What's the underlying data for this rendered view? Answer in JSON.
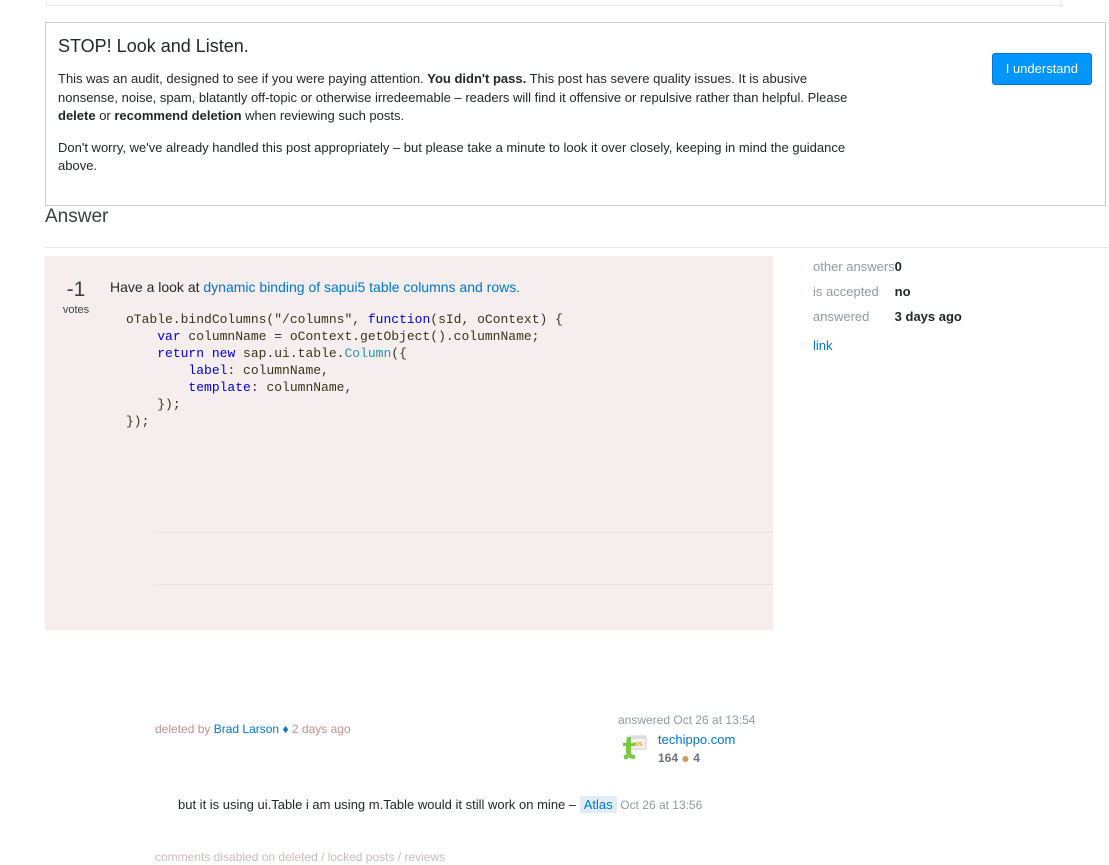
{
  "audit": {
    "title": "STOP! Look and Listen.",
    "para1_a": "This was an audit, designed to see if you were paying attention. ",
    "para1_bold1": "You didn't pass.",
    "para1_b": " This post has severe quality issues. It is abusive nonsense, noise, spam, blatantly off-topic or otherwise irredeemable – readers will find it offensive or repulsive rather than helpful. Please ",
    "para1_bold2": "delete",
    "para1_c": " or ",
    "para1_bold3": "recommend deletion",
    "para1_d": " when reviewing such posts.",
    "para2": "Don't worry, we've already handled this post appropriately – but please take a minute to look it over closely, keeping in mind the guidance above.",
    "button_label": "I understand",
    "button_color": "#0095ff"
  },
  "answer_section": {
    "heading": "Answer"
  },
  "post": {
    "vote_count": "-1",
    "vote_label": "votes",
    "body_prefix": "Have a look at ",
    "body_link": "dynamic binding of sapui5 table columns and rows.",
    "code": {
      "line1_a": "oTable.bindColumns(",
      "line1_str": "\"/columns\"",
      "line1_b": ", ",
      "line1_kw": "function",
      "line1_c": "(sId, oContext) {",
      "line2_kw": "var",
      "line2_a": " columnName = oContext.getObject().columnName;",
      "line3_kw1": "return",
      "line3_kw2": "new",
      "line3_a": " sap.ui.table.",
      "line3_type": "Column",
      "line3_b": "({",
      "line4_prop": "label",
      "line4_a": ": columnName,",
      "line5_prop": "template",
      "line5_a": ": columnName,",
      "line6": "});",
      "line7": "});"
    },
    "deleted_by_prefix": "deleted by ",
    "deleted_by_user": "Brad Larson",
    "mod_diamond": "♦",
    "deleted_when": "2 days ago",
    "answered_when": "answered Oct 26 at 13:54",
    "author_name": "techippo.com",
    "author_rep": "164",
    "badge_dot": "●",
    "badge_count": "4",
    "avatar_name": "techippo-avatar"
  },
  "comment": {
    "text": "but it is using ui.Table i am using m.Table would it still work on mine – ",
    "user": "Atlas",
    "date": "Oct 26 at 13:56",
    "disabled_notice": "comments disabled on deleted / locked posts / reviews"
  },
  "stats": {
    "rows": [
      {
        "key": "other answers",
        "value": "0"
      },
      {
        "key": "is accepted",
        "value": "no"
      },
      {
        "key": "answered",
        "value": "3 days ago"
      }
    ],
    "link_label": "link"
  }
}
